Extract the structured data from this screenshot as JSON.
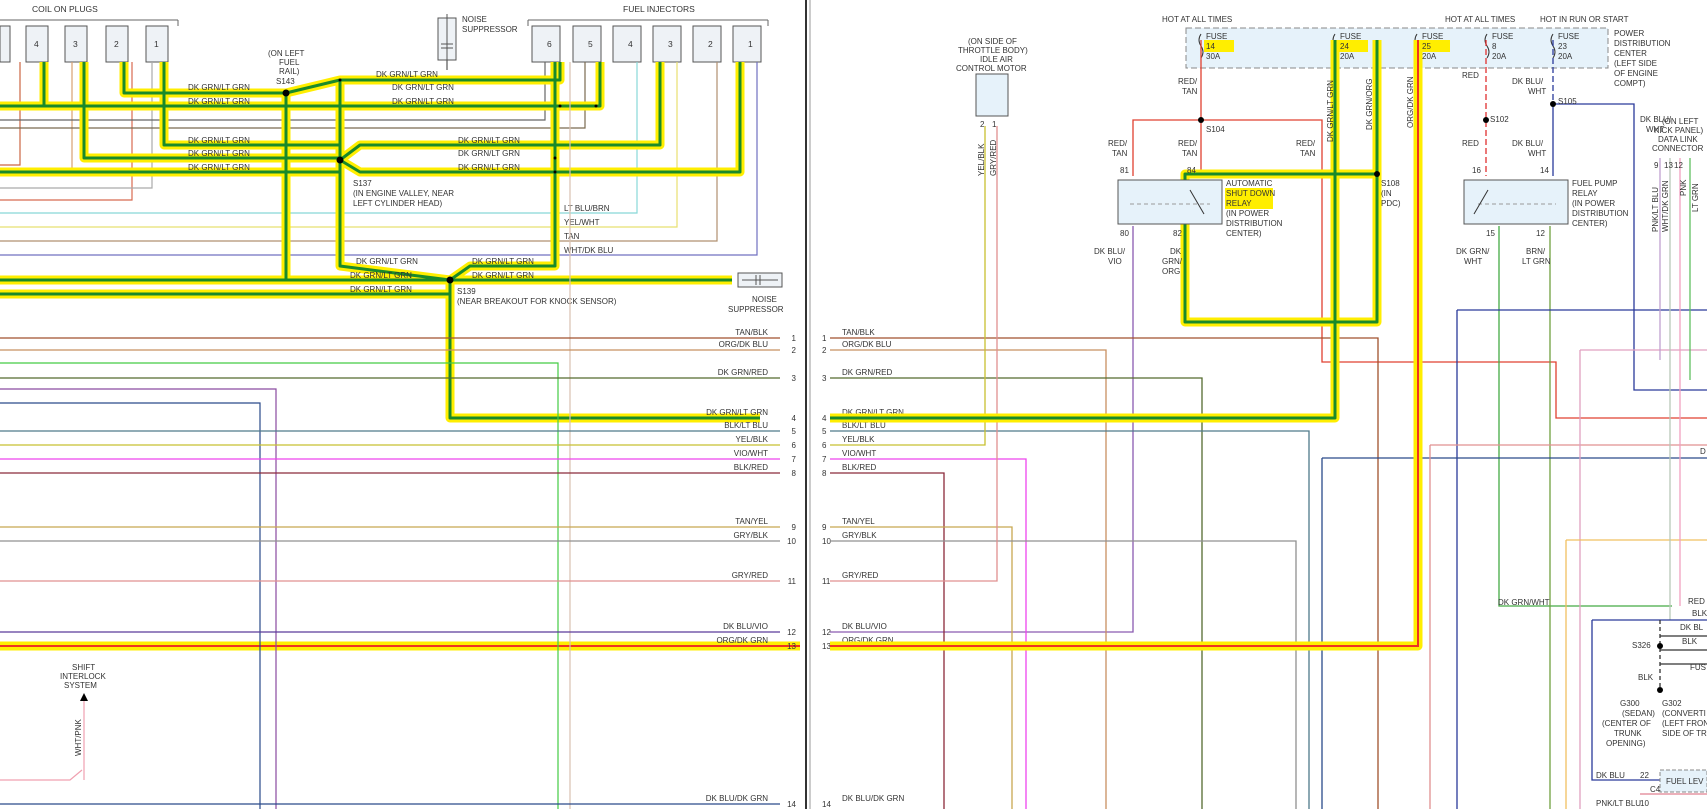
{
  "title_coil": "COIL ON PLUGS",
  "title_injectors": "FUEL INJECTORS",
  "noise_suppressor_1": [
    "NOISE",
    "SUPPRESSOR"
  ],
  "noise_suppressor_2": [
    "NOISE",
    "SUPPRESSOR"
  ],
  "coils": [
    "4",
    "3",
    "2",
    "1"
  ],
  "injectors": [
    "6",
    "5",
    "4",
    "3",
    "2",
    "1"
  ],
  "s143": [
    "(ON LEFT",
    "FUEL",
    "RAIL)",
    "S143"
  ],
  "s137": [
    "S137",
    "(IN ENGINE VALLEY, NEAR",
    "LEFT CYLINDER HEAD)"
  ],
  "s139": [
    "S139",
    "(NEAR BREAKOUT FOR KNOCK SENSOR)"
  ],
  "dkgrn": "DK GRN/LT GRN",
  "left_wire_labels": [
    "LT BLU/BRN",
    "YEL/WHT",
    "TAN",
    "WHT/DK BLU"
  ],
  "connector_rows": [
    {
      "pin": "1",
      "left": "TAN/BLK",
      "right": "TAN/BLK",
      "color": "#a0522d"
    },
    {
      "pin": "2",
      "left": "ORG/DK BLU",
      "right": "ORG/DK BLU",
      "color": "#c89060"
    },
    {
      "pin": "3",
      "left": "DK GRN/RED",
      "right": "DK GRN/RED",
      "color": "#556b2f"
    },
    {
      "pin": "4",
      "left": "DK GRN/LT GRN",
      "right": "DK GRN/LT GRN",
      "color": "#2e8b57"
    },
    {
      "pin": "5",
      "left": "BLK/LT BLU",
      "right": "BLK/LT BLU",
      "color": "#4f7a8a"
    },
    {
      "pin": "6",
      "left": "YEL/BLK",
      "right": "YEL/BLK",
      "color": "#c8c030"
    },
    {
      "pin": "7",
      "left": "VIO/WHT",
      "right": "VIO/WHT",
      "color": "#ee44ee"
    },
    {
      "pin": "8",
      "left": "BLK/RED",
      "right": "BLK/RED",
      "color": "#8b2a3a"
    },
    {
      "pin": "9",
      "left": "TAN/YEL",
      "right": "TAN/YEL",
      "color": "#c8a850"
    },
    {
      "pin": "10",
      "left": "GRY/BLK",
      "right": "GRY/BLK",
      "color": "#909090"
    },
    {
      "pin": "11",
      "left": "GRY/RED",
      "right": "GRY/RED",
      "color": "#e09090"
    },
    {
      "pin": "12",
      "left": "DK BLU/VIO",
      "right": "DK BLU/VIO",
      "color": "#5a3a9a"
    },
    {
      "pin": "13",
      "left": "ORG/DK GRN",
      "right": "ORG/DK GRN",
      "color": "#d06030"
    },
    {
      "pin": "14",
      "left": "DK BLU/DK GRN",
      "right": "DK BLU/DK GRN",
      "color": "#2a4a8a"
    }
  ],
  "shift_interlock": [
    "SHIFT",
    "INTERLOCK",
    "SYSTEM"
  ],
  "wht_pnk": "WHT/PNK",
  "iac": [
    "(ON SIDE OF",
    "THROTTLE BODY)",
    "IDLE AIR",
    "CONTROL MOTOR"
  ],
  "iac_wires": [
    "YEL/BLK",
    "GRY/RED"
  ],
  "iac_pins": [
    "2",
    "1"
  ],
  "hot_all_times": "HOT AT ALL TIMES",
  "hot_run_start": "HOT IN RUN OR START",
  "fuses": [
    {
      "name": "FUSE",
      "num": "14",
      "amp": "30A",
      "hl": true
    },
    {
      "name": "FUSE",
      "num": "24",
      "amp": "20A",
      "hl": true
    },
    {
      "name": "FUSE",
      "num": "25",
      "amp": "20A",
      "hl": true
    },
    {
      "name": "FUSE",
      "num": "8",
      "amp": "20A",
      "hl": false
    },
    {
      "name": "FUSE",
      "num": "23",
      "amp": "20A",
      "hl": false
    }
  ],
  "pdc": [
    "POWER",
    "DISTRIBUTION",
    "CENTER",
    "(LEFT SIDE",
    "OF ENGINE",
    "COMPT)"
  ],
  "asd_relay": [
    "AUTOMATIC",
    "SHUT DOWN",
    "RELAY",
    "(IN POWER",
    "DISTRIBUTION",
    "CENTER)"
  ],
  "fp_relay": [
    "FUEL PUMP",
    "RELAY",
    "(IN POWER",
    "DISTRIBUTION",
    "CENTER)"
  ],
  "s104": "S104",
  "s102": "S102",
  "s105": "S105",
  "s108": [
    "S108",
    "(IN",
    "PDC)"
  ],
  "red_tan": [
    "RED/",
    "TAN"
  ],
  "red": "RED",
  "dk_blu_wht": [
    "DK BLU/",
    "WHT"
  ],
  "dk_blu_vio": [
    "DK BLU/",
    "VIO"
  ],
  "dk_grn_org": [
    "DK",
    "GRN/",
    "ORG"
  ],
  "dk_grn_wht": [
    "DK GRN/",
    "WHT"
  ],
  "brn_lt_grn": [
    "BRN/",
    "LT GRN"
  ],
  "dk_grn_lt_grn_v": "DK GRN/LT GRN",
  "dk_grn_org_v1": "DK GRN/ORG",
  "dk_grn_org_v2": "ORG/DK GRN",
  "relay_pins": [
    "81",
    "84",
    "80",
    "82",
    "16",
    "14",
    "15",
    "12"
  ],
  "data_link": [
    "(ON LEFT",
    "KICK PANEL)",
    "DATA LINK",
    "CONNECTOR"
  ],
  "dlc_wires": [
    "PNK/LT BLU",
    "WHT/DK GRN",
    "PNK",
    "LT GRN"
  ],
  "dlc_pins": [
    "9",
    "13",
    "12"
  ],
  "dk_grn_wht_h": "DK GRN/WHT",
  "s326": "S326",
  "blk": "BLK",
  "g300": [
    "G300",
    "(SEDAN)",
    "(CENTER OF",
    "TRUNK",
    "OPENING)"
  ],
  "g302": [
    "G302",
    "(CONVERTI",
    "(LEFT FRON",
    "SIDE OF TR"
  ],
  "fuel_lev": "FUEL LEV",
  "dk_blu_22": [
    "DK BLU",
    "22"
  ],
  "pnk_lt_blu_10": [
    "PNK/LT BLU",
    "10"
  ],
  "c4": "C4",
  "right_edge": [
    "RED",
    "BLK",
    "DK BL",
    "BLK",
    "FUS"
  ],
  "d_frag": "D",
  "dk_blu_wht_r": [
    "DK BLU/",
    "WHT"
  ]
}
